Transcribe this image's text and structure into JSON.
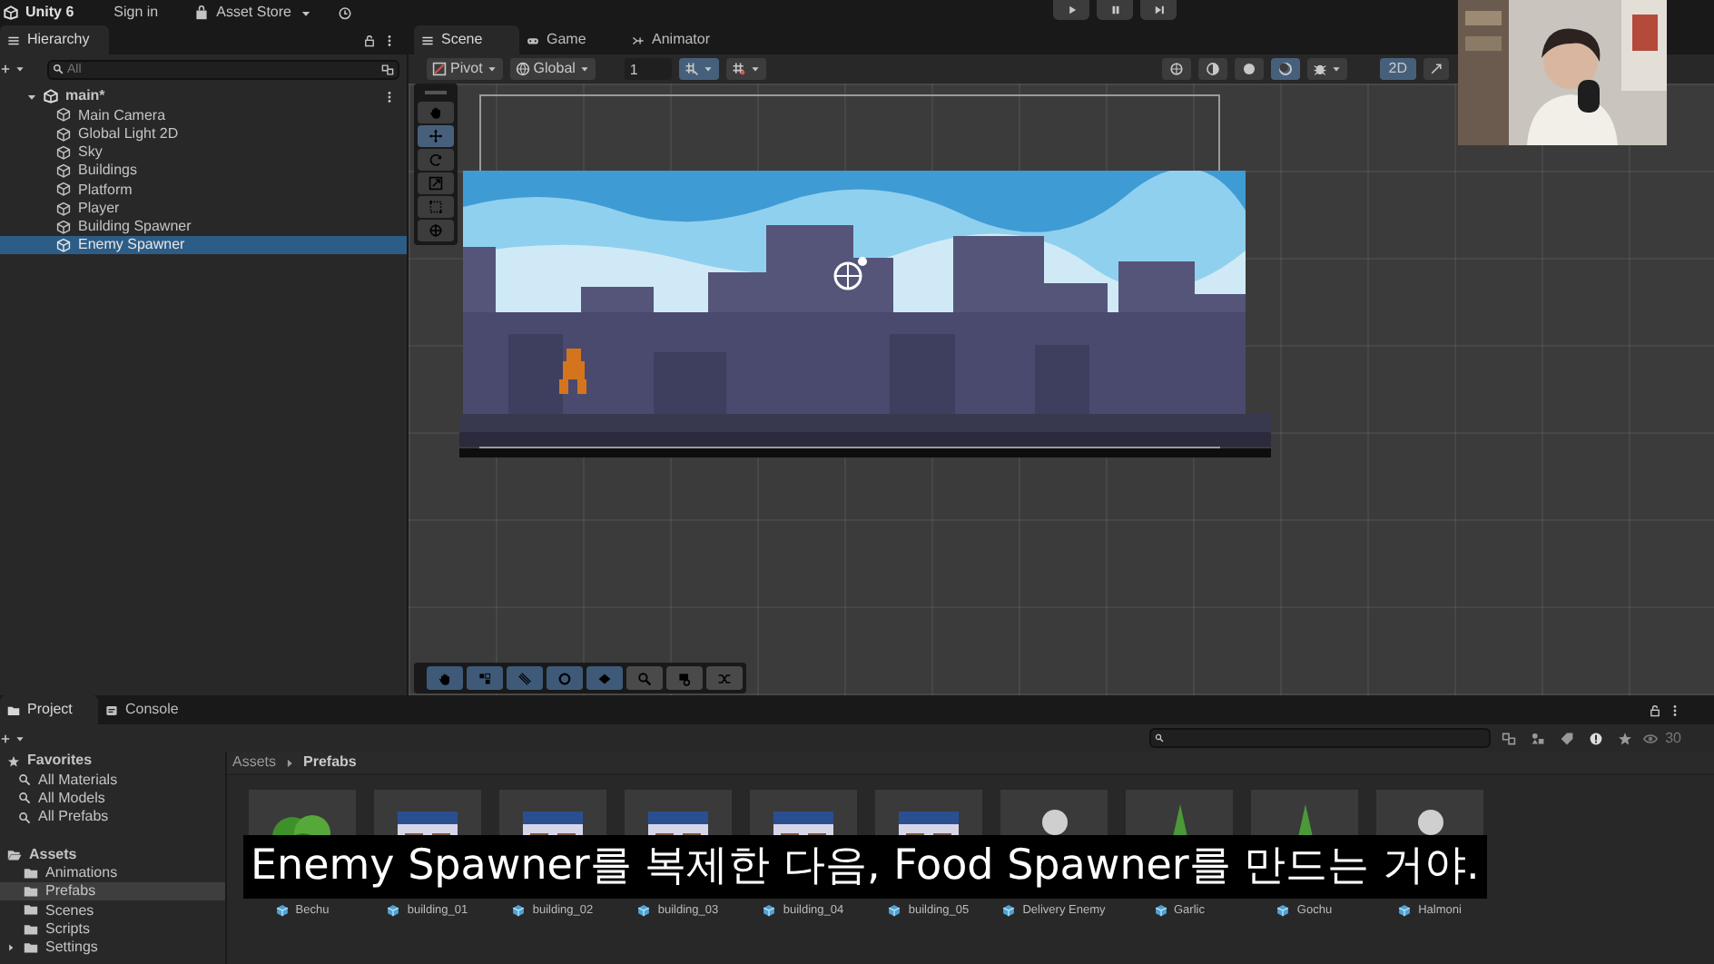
{
  "app": {
    "title": "Unity 6",
    "sign_in": "Sign in",
    "asset_store": "Asset Store"
  },
  "hierarchy": {
    "tab": "Hierarchy",
    "search_placeholder": "All",
    "scene": {
      "name": "main*",
      "expanded": true,
      "children": [
        {
          "label": "Main Camera",
          "selected": false
        },
        {
          "label": "Global Light 2D",
          "selected": false
        },
        {
          "label": "Sky",
          "selected": false
        },
        {
          "label": "Buildings",
          "selected": false
        },
        {
          "label": "Platform",
          "selected": false
        },
        {
          "label": "Player",
          "selected": false
        },
        {
          "label": "Building Spawner",
          "selected": false
        },
        {
          "label": "Enemy Spawner",
          "selected": true
        }
      ]
    }
  },
  "scene_view": {
    "tabs": [
      {
        "label": "Scene",
        "kind": "scene",
        "selected": true
      },
      {
        "label": "Game",
        "kind": "game",
        "selected": false
      },
      {
        "label": "Animator",
        "kind": "animator",
        "selected": false
      }
    ],
    "pivot": "Pivot",
    "space": "Global",
    "grid_size": "1",
    "snap_on": true,
    "mode_2d": {
      "label": "2D",
      "on": true
    },
    "tools": [
      {
        "kind": "hand",
        "selected": false
      },
      {
        "kind": "move",
        "selected": true
      },
      {
        "kind": "rotate",
        "selected": false
      },
      {
        "kind": "scale",
        "selected": false
      },
      {
        "kind": "rect",
        "selected": false
      },
      {
        "kind": "transform",
        "selected": false
      }
    ],
    "tile_tools": [
      {
        "kind": "hand",
        "on": true
      },
      {
        "kind": "grid",
        "on": true
      },
      {
        "kind": "brush",
        "on": true
      },
      {
        "kind": "ring",
        "on": true
      },
      {
        "kind": "fill",
        "on": true
      },
      {
        "kind": "search",
        "on": false
      },
      {
        "kind": "stamp",
        "on": false
      },
      {
        "kind": "shuffle",
        "on": false
      }
    ]
  },
  "project": {
    "tabs": [
      {
        "label": "Project",
        "kind": "folder",
        "selected": true
      },
      {
        "label": "Console",
        "kind": "console",
        "selected": false
      }
    ],
    "favorites": {
      "label": "Favorites",
      "items": [
        "All Materials",
        "All Models",
        "All Prefabs"
      ]
    },
    "assets": {
      "label": "Assets",
      "children": [
        {
          "label": "Animations",
          "selected": false,
          "expandable": false
        },
        {
          "label": "Prefabs",
          "selected": true,
          "expandable": false
        },
        {
          "label": "Scenes",
          "selected": false,
          "expandable": false
        },
        {
          "label": "Scripts",
          "selected": false,
          "expandable": false
        },
        {
          "label": "Settings",
          "selected": false,
          "expandable": true
        }
      ]
    },
    "breadcrumb": [
      "Assets",
      "Prefabs"
    ],
    "visible_count": "30",
    "items": [
      {
        "name": "Bechu",
        "kind": "bush"
      },
      {
        "name": "building_01",
        "kind": "building"
      },
      {
        "name": "building_02",
        "kind": "building"
      },
      {
        "name": "building_03",
        "kind": "building"
      },
      {
        "name": "building_04",
        "kind": "building"
      },
      {
        "name": "building_05",
        "kind": "building"
      },
      {
        "name": "Delivery Enemy",
        "kind": "person"
      },
      {
        "name": "Garlic",
        "kind": "plant"
      },
      {
        "name": "Gochu",
        "kind": "plant"
      },
      {
        "name": "Halmoni",
        "kind": "person"
      }
    ]
  },
  "subtitle": "Enemy Spawner를 복제한 다음, Food Spawner를 만드는 거야."
}
